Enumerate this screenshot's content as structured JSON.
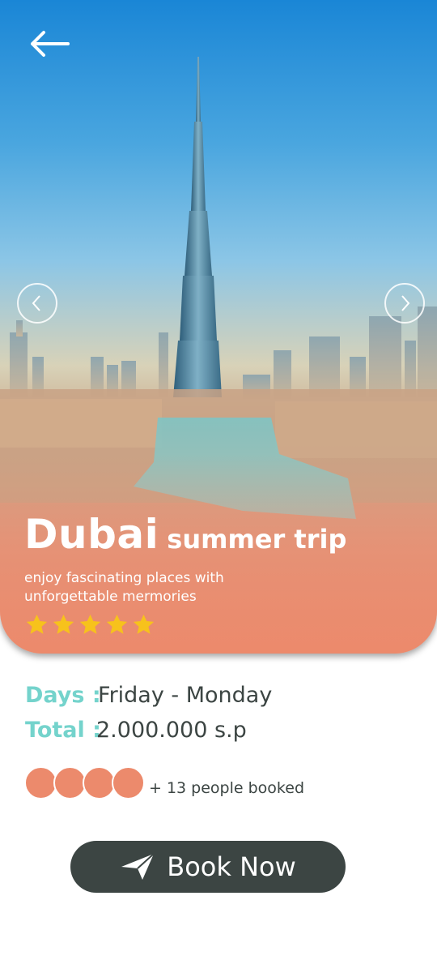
{
  "trip": {
    "destination": "Dubai",
    "trip_type": "summer trip",
    "tagline": "enjoy fascinating places with unforgettable mermories",
    "rating_stars": 5
  },
  "details": {
    "days_label": "Days :",
    "days_value": "Friday - Monday",
    "total_label": "Total :",
    "total_value": "2.000.000 s.p"
  },
  "bookings": {
    "avatar_count": 4,
    "text": "+ 13 people booked"
  },
  "actions": {
    "book_label": "Book Now"
  },
  "icons": {
    "back": "back-arrow-icon",
    "prev": "chevron-left-icon",
    "next": "chevron-right-icon",
    "star": "star-icon",
    "send": "send-icon"
  },
  "colors": {
    "accent": "#74d3cc",
    "coral": "#ec8a6c",
    "dark": "#3c4543",
    "star": "#f7c21c",
    "sky_top": "#1a86d6"
  }
}
